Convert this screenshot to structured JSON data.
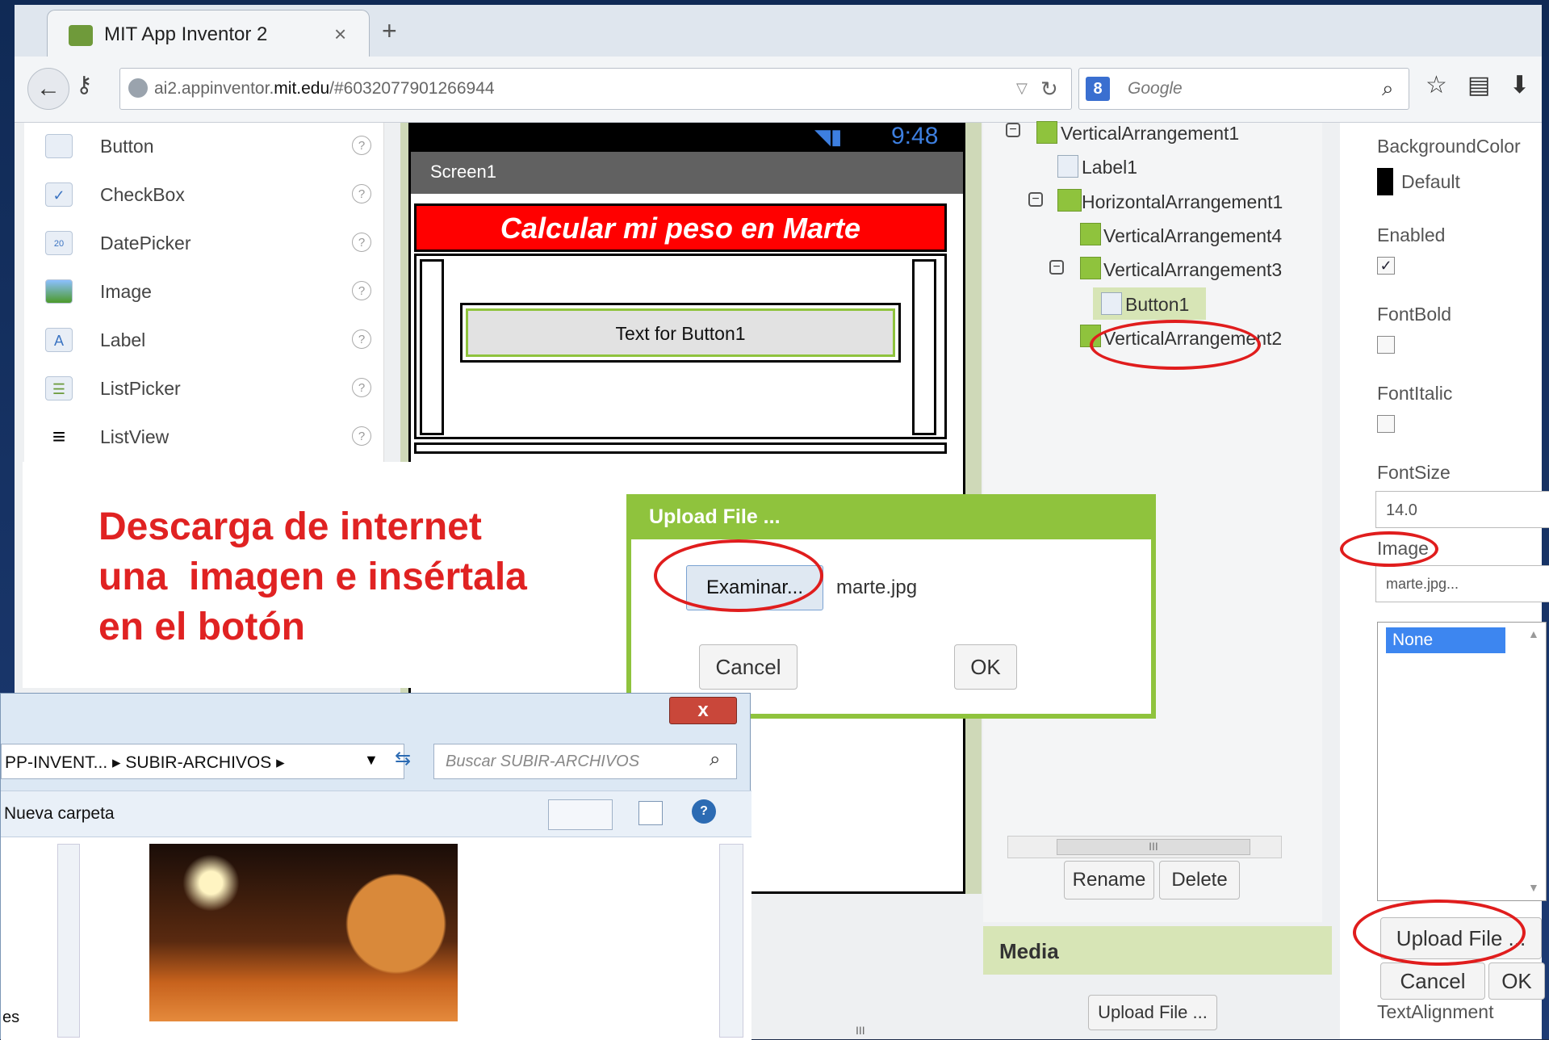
{
  "browser": {
    "tab_title": "MIT App Inventor 2",
    "tab_close": "×",
    "new_tab": "+",
    "url_host": "ai2.appinventor.",
    "url_domain": "mit.edu",
    "url_path": "/#6032077901266944",
    "search_placeholder": "Google",
    "search_engine_badge": "8"
  },
  "palette": {
    "items": [
      {
        "label": "Button",
        "icon": "button-icon"
      },
      {
        "label": "CheckBox",
        "icon": "checkbox-icon"
      },
      {
        "label": "DatePicker",
        "icon": "datepicker-icon"
      },
      {
        "label": "Image",
        "icon": "image-icon"
      },
      {
        "label": "Label",
        "icon": "label-icon"
      },
      {
        "label": "ListPicker",
        "icon": "listpicker-icon"
      },
      {
        "label": "ListView",
        "icon": "listview-icon"
      }
    ],
    "help": "?"
  },
  "viewer": {
    "status_time": "9:48",
    "screen_title": "Screen1",
    "banner_text": "Calcular mi peso en Marte",
    "button_text": "Text for Button1"
  },
  "instruction": {
    "line1": "Descarga de internet",
    "line2": "una  imagen e insértala",
    "line3": "en el botón"
  },
  "upload_dialog": {
    "title": "Upload File ...",
    "browse_label": "Examinar...",
    "file_name": "marte.jpg",
    "cancel": "Cancel",
    "ok": "OK"
  },
  "components_tree": {
    "items": [
      {
        "label": "VerticalArrangement1"
      },
      {
        "label": "Label1"
      },
      {
        "label": "HorizontalArrangement1"
      },
      {
        "label": "VerticalArrangement4"
      },
      {
        "label": "VerticalArrangement3"
      },
      {
        "label": "Button1"
      },
      {
        "label": "VerticalArrangement2"
      }
    ],
    "rename": "Rename",
    "delete": "Delete",
    "scroll_grip": "III"
  },
  "media": {
    "title": "Media",
    "upload": "Upload File ..."
  },
  "properties": {
    "background_color_label": "BackgroundColor",
    "background_color_value": "Default",
    "enabled_label": "Enabled",
    "enabled_checked": "✓",
    "fontbold_label": "FontBold",
    "fontitalic_label": "FontItalic",
    "fontsize_label": "FontSize",
    "fontsize_value": "14.0",
    "image_label": "Image",
    "image_value": "marte.jpg...",
    "asset_selected": "None",
    "upload_file": "Upload File ...",
    "cancel": "Cancel",
    "ok": "OK",
    "text_alignment_label": "TextAlignment"
  },
  "file_dialog": {
    "close": "x",
    "path": "PP-INVENT... ▸ SUBIR-ARCHIVOS ▸",
    "search_placeholder": "Buscar SUBIR-ARCHIVOS",
    "new_folder": "Nueva carpeta",
    "left_item": "es",
    "scroll_grip": "III"
  }
}
